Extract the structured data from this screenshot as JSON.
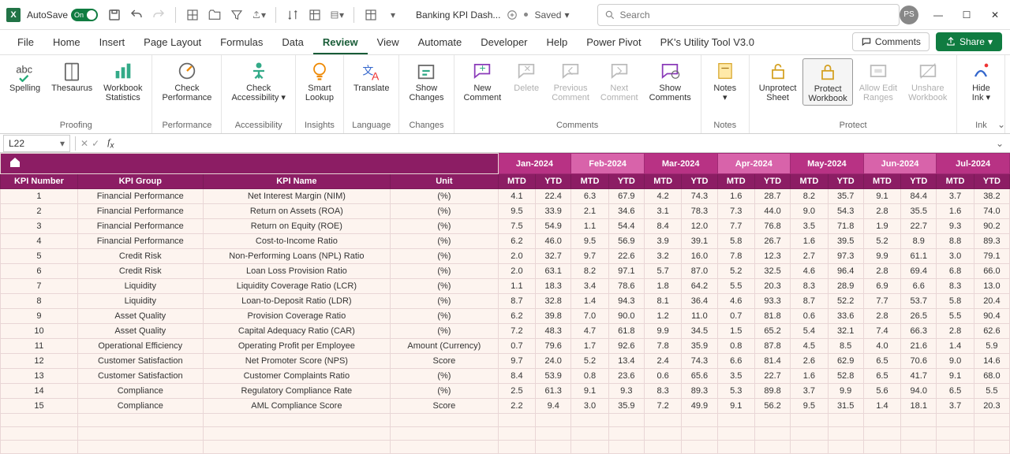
{
  "titlebar": {
    "autosave_label": "AutoSave",
    "toggle_text": "On",
    "filename": "Banking KPI Dash...",
    "saved_label": "Saved",
    "search_placeholder": "Search",
    "avatar_initials": "PS"
  },
  "tabs": {
    "items": [
      "File",
      "Home",
      "Insert",
      "Page Layout",
      "Formulas",
      "Data",
      "Review",
      "View",
      "Automate",
      "Developer",
      "Help",
      "Power Pivot",
      "PK's Utility Tool V3.0"
    ],
    "active_index": 6,
    "comments_btn": "Comments",
    "share_btn": "Share"
  },
  "ribbon": {
    "groups": [
      {
        "label": "Proofing",
        "items": [
          {
            "label": "Spelling",
            "icon": "abc"
          },
          {
            "label": "Thesaurus",
            "icon": "book"
          },
          {
            "label": "Workbook\nStatistics",
            "icon": "stats"
          }
        ]
      },
      {
        "label": "Performance",
        "items": [
          {
            "label": "Check\nPerformance",
            "icon": "perf"
          }
        ]
      },
      {
        "label": "Accessibility",
        "items": [
          {
            "label": "Check\nAccessibility ▾",
            "icon": "access"
          }
        ]
      },
      {
        "label": "Insights",
        "items": [
          {
            "label": "Smart\nLookup",
            "icon": "bulb"
          }
        ]
      },
      {
        "label": "Language",
        "items": [
          {
            "label": "Translate",
            "icon": "translate"
          }
        ]
      },
      {
        "label": "Changes",
        "items": [
          {
            "label": "Show\nChanges",
            "icon": "changes"
          }
        ]
      },
      {
        "label": "Comments",
        "items": [
          {
            "label": "New\nComment",
            "icon": "newc"
          },
          {
            "label": "Delete",
            "icon": "del",
            "disabled": true
          },
          {
            "label": "Previous\nComment",
            "icon": "prevc",
            "disabled": true
          },
          {
            "label": "Next\nComment",
            "icon": "nextc",
            "disabled": true
          },
          {
            "label": "Show\nComments",
            "icon": "showc"
          }
        ]
      },
      {
        "label": "Notes",
        "items": [
          {
            "label": "Notes\n▾",
            "icon": "notes"
          }
        ]
      },
      {
        "label": "Protect",
        "items": [
          {
            "label": "Unprotect\nSheet",
            "icon": "unlock"
          },
          {
            "label": "Protect\nWorkbook",
            "icon": "lockwb",
            "active": true
          },
          {
            "label": "Allow Edit\nRanges",
            "icon": "ranges",
            "disabled": true
          },
          {
            "label": "Unshare\nWorkbook",
            "icon": "unshare",
            "disabled": true
          }
        ]
      },
      {
        "label": "Ink",
        "items": [
          {
            "label": "Hide\nInk ▾",
            "icon": "ink"
          }
        ]
      }
    ]
  },
  "formula_bar": {
    "namebox": "L22",
    "formula": ""
  },
  "grid": {
    "id_headers": [
      "KPI Number",
      "KPI Group",
      "KPI Name",
      "Unit"
    ],
    "months": [
      "Jan-2024",
      "Feb-2024",
      "Mar-2024",
      "Apr-2024",
      "May-2024",
      "Jun-2024",
      "Jul-2024"
    ],
    "sub_headers": [
      "MTD",
      "YTD"
    ],
    "rows": [
      {
        "num": 1,
        "group": "Financial Performance",
        "name": "Net Interest Margin (NIM)",
        "unit": "(%)",
        "vals": [
          4.1,
          22.4,
          6.3,
          67.9,
          4.2,
          74.3,
          1.6,
          28.7,
          8.2,
          35.7,
          9.1,
          84.4,
          3.7,
          38.2
        ]
      },
      {
        "num": 2,
        "group": "Financial Performance",
        "name": "Return on Assets (ROA)",
        "unit": "(%)",
        "vals": [
          9.5,
          33.9,
          2.1,
          34.6,
          3.1,
          78.3,
          7.3,
          44.0,
          9.0,
          54.3,
          2.8,
          35.5,
          1.6,
          74.0
        ]
      },
      {
        "num": 3,
        "group": "Financial Performance",
        "name": "Return on Equity (ROE)",
        "unit": "(%)",
        "vals": [
          7.5,
          54.9,
          1.1,
          54.4,
          8.4,
          12.0,
          7.7,
          76.8,
          3.5,
          71.8,
          1.9,
          22.7,
          9.3,
          90.2
        ]
      },
      {
        "num": 4,
        "group": "Financial Performance",
        "name": "Cost-to-Income Ratio",
        "unit": "(%)",
        "vals": [
          6.2,
          46.0,
          9.5,
          56.9,
          3.9,
          39.1,
          5.8,
          26.7,
          1.6,
          39.5,
          5.2,
          8.9,
          8.8,
          89.3
        ]
      },
      {
        "num": 5,
        "group": "Credit Risk",
        "name": "Non-Performing Loans (NPL) Ratio",
        "unit": "(%)",
        "vals": [
          2.0,
          32.7,
          9.7,
          22.6,
          3.2,
          16.0,
          7.8,
          12.3,
          2.7,
          97.3,
          9.9,
          61.1,
          3.0,
          79.1
        ]
      },
      {
        "num": 6,
        "group": "Credit Risk",
        "name": "Loan Loss Provision Ratio",
        "unit": "(%)",
        "vals": [
          2.0,
          63.1,
          8.2,
          97.1,
          5.7,
          87.0,
          5.2,
          32.5,
          4.6,
          96.4,
          2.8,
          69.4,
          6.8,
          66.0
        ]
      },
      {
        "num": 7,
        "group": "Liquidity",
        "name": "Liquidity Coverage Ratio (LCR)",
        "unit": "(%)",
        "vals": [
          1.1,
          18.3,
          3.4,
          78.6,
          1.8,
          64.2,
          5.5,
          20.3,
          8.3,
          28.9,
          6.9,
          6.6,
          8.3,
          13.0
        ]
      },
      {
        "num": 8,
        "group": "Liquidity",
        "name": "Loan-to-Deposit Ratio (LDR)",
        "unit": "(%)",
        "vals": [
          8.7,
          32.8,
          1.4,
          94.3,
          8.1,
          36.4,
          4.6,
          93.3,
          8.7,
          52.2,
          7.7,
          53.7,
          5.8,
          20.4
        ]
      },
      {
        "num": 9,
        "group": "Asset Quality",
        "name": "Provision Coverage Ratio",
        "unit": "(%)",
        "vals": [
          6.2,
          39.8,
          7.0,
          90.0,
          1.2,
          11.0,
          0.7,
          81.8,
          0.6,
          33.6,
          2.8,
          26.5,
          5.5,
          90.4
        ]
      },
      {
        "num": 10,
        "group": "Asset Quality",
        "name": "Capital Adequacy Ratio (CAR)",
        "unit": "(%)",
        "vals": [
          7.2,
          48.3,
          4.7,
          61.8,
          9.9,
          34.5,
          1.5,
          65.2,
          5.4,
          32.1,
          7.4,
          66.3,
          2.8,
          62.6
        ]
      },
      {
        "num": 11,
        "group": "Operational Efficiency",
        "name": "Operating Profit per Employee",
        "unit": "Amount (Currency)",
        "vals": [
          0.7,
          79.6,
          1.7,
          92.6,
          7.8,
          35.9,
          0.8,
          87.8,
          4.5,
          8.5,
          4.0,
          21.6,
          1.4,
          5.9
        ]
      },
      {
        "num": 12,
        "group": "Customer Satisfaction",
        "name": "Net Promoter Score (NPS)",
        "unit": "Score",
        "vals": [
          9.7,
          24.0,
          5.2,
          13.4,
          2.4,
          74.3,
          6.6,
          81.4,
          2.6,
          62.9,
          6.5,
          70.6,
          9.0,
          14.6
        ]
      },
      {
        "num": 13,
        "group": "Customer Satisfaction",
        "name": "Customer Complaints Ratio",
        "unit": "(%)",
        "vals": [
          8.4,
          53.9,
          0.8,
          23.6,
          0.6,
          65.6,
          3.5,
          22.7,
          1.6,
          52.8,
          6.5,
          41.7,
          9.1,
          68.0
        ]
      },
      {
        "num": 14,
        "group": "Compliance",
        "name": "Regulatory Compliance Rate",
        "unit": "(%)",
        "vals": [
          2.5,
          61.3,
          9.1,
          9.3,
          8.3,
          89.3,
          5.3,
          89.8,
          3.7,
          9.9,
          5.6,
          94.0,
          6.5,
          5.5
        ]
      },
      {
        "num": 15,
        "group": "Compliance",
        "name": "AML Compliance Score",
        "unit": "Score",
        "vals": [
          2.2,
          9.4,
          3.0,
          35.9,
          7.2,
          49.9,
          9.1,
          56.2,
          9.5,
          31.5,
          1.4,
          18.1,
          3.7,
          20.3
        ]
      }
    ]
  }
}
